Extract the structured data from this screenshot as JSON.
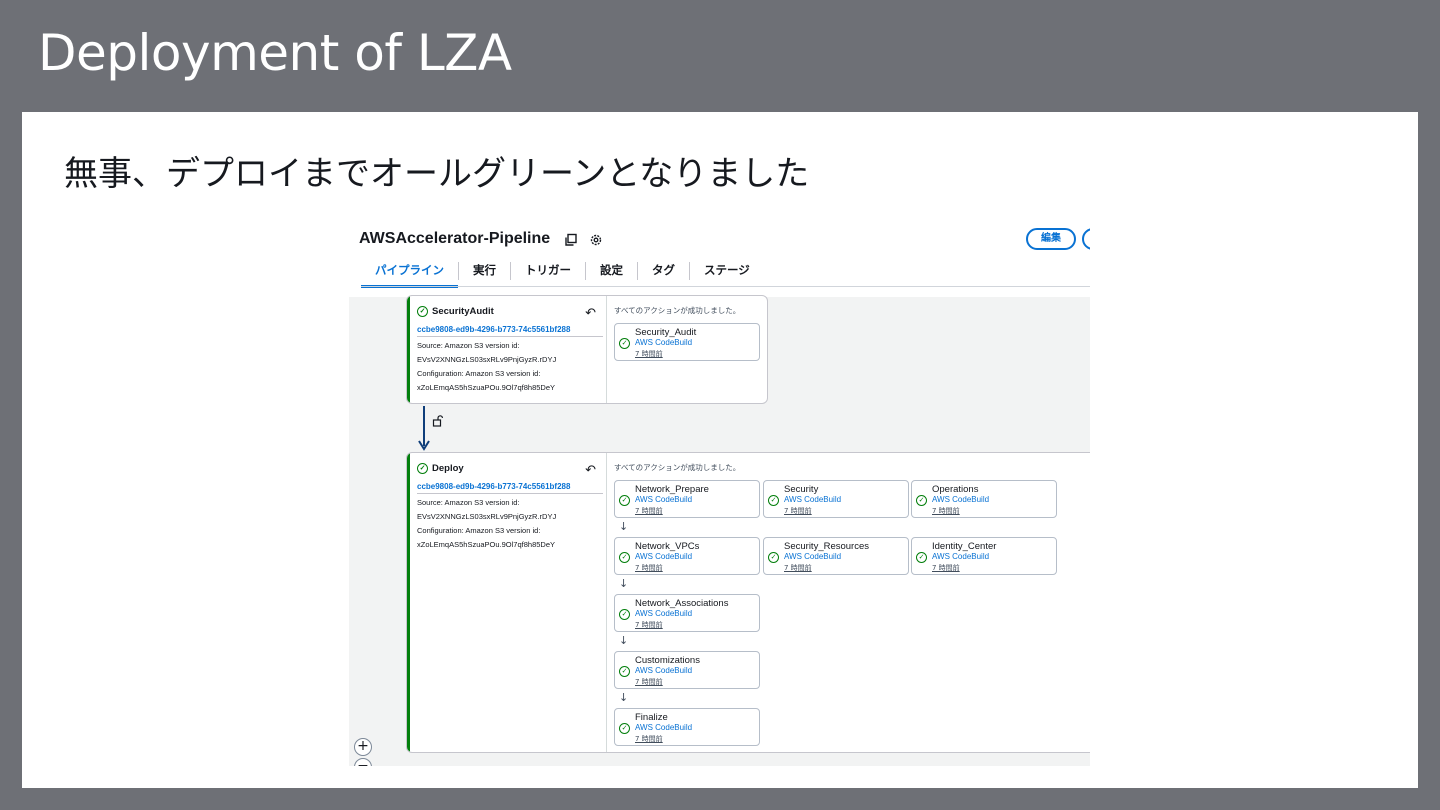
{
  "slide": {
    "title": "Deployment of LZA",
    "subtitle": "無事、デプロイまでオールグリーンとなりました"
  },
  "header": {
    "pipeline_name": "AWSAccelerator-Pipeline",
    "copy_icon": "copy-icon",
    "settings_icon": "gear-icon",
    "edit_label": "編集"
  },
  "tabs": [
    {
      "label": "パイプライン",
      "active": true
    },
    {
      "label": "実行"
    },
    {
      "label": "トリガー"
    },
    {
      "label": "設定"
    },
    {
      "label": "タグ"
    },
    {
      "label": "ステージ"
    }
  ],
  "stages": [
    {
      "name": "SecurityAudit",
      "execution_id": "ccbe9808-ed9b-4296-b773-74c5561bf288",
      "source_label": "Source: Amazon S3 version id:",
      "source_value": "EVsV2XNNGzLS03sxRLv9PnjGyzR.rDYJ",
      "config_label": "Configuration: Amazon S3 version id:",
      "config_value": "xZoLEmqAS5hSzuaPOu.9Ol7qf8h85DeY",
      "status": "すべてのアクションが成功しました。",
      "actions": [
        {
          "name": "Security_Audit",
          "provider": "AWS CodeBuild",
          "time": "7 時間前"
        }
      ]
    },
    {
      "name": "Deploy",
      "execution_id": "ccbe9808-ed9b-4296-b773-74c5561bf288",
      "source_label": "Source: Amazon S3 version id:",
      "source_value": "EVsV2XNNGzLS03sxRLv9PnjGyzR.rDYJ",
      "config_label": "Configuration: Amazon S3 version id:",
      "config_value": "xZoLEmqAS5hSzuaPOu.9Ol7qf8h85DeY",
      "status": "すべてのアクションが成功しました。",
      "actions": [
        {
          "name": "Network_Prepare",
          "provider": "AWS CodeBuild",
          "time": "7 時間前"
        },
        {
          "name": "Security",
          "provider": "AWS CodeBuild",
          "time": "7 時間前"
        },
        {
          "name": "Operations",
          "provider": "AWS CodeBuild",
          "time": "7 時間前"
        },
        {
          "name": "Network_VPCs",
          "provider": "AWS CodeBuild",
          "time": "7 時間前"
        },
        {
          "name": "Security_Resources",
          "provider": "AWS CodeBuild",
          "time": "7 時間前"
        },
        {
          "name": "Identity_Center",
          "provider": "AWS CodeBuild",
          "time": "7 時間前"
        },
        {
          "name": "Network_Associations",
          "provider": "AWS CodeBuild",
          "time": "7 時間前"
        },
        {
          "name": "Customizations",
          "provider": "AWS CodeBuild",
          "time": "7 時間前"
        },
        {
          "name": "Finalize",
          "provider": "AWS CodeBuild",
          "time": "7 時間前"
        }
      ]
    }
  ],
  "zoom": {
    "in_label": "+",
    "out_label": "−"
  },
  "colors": {
    "accent": "#0972d3",
    "success": "#037f0c",
    "slide_bg": "#6e7076"
  }
}
